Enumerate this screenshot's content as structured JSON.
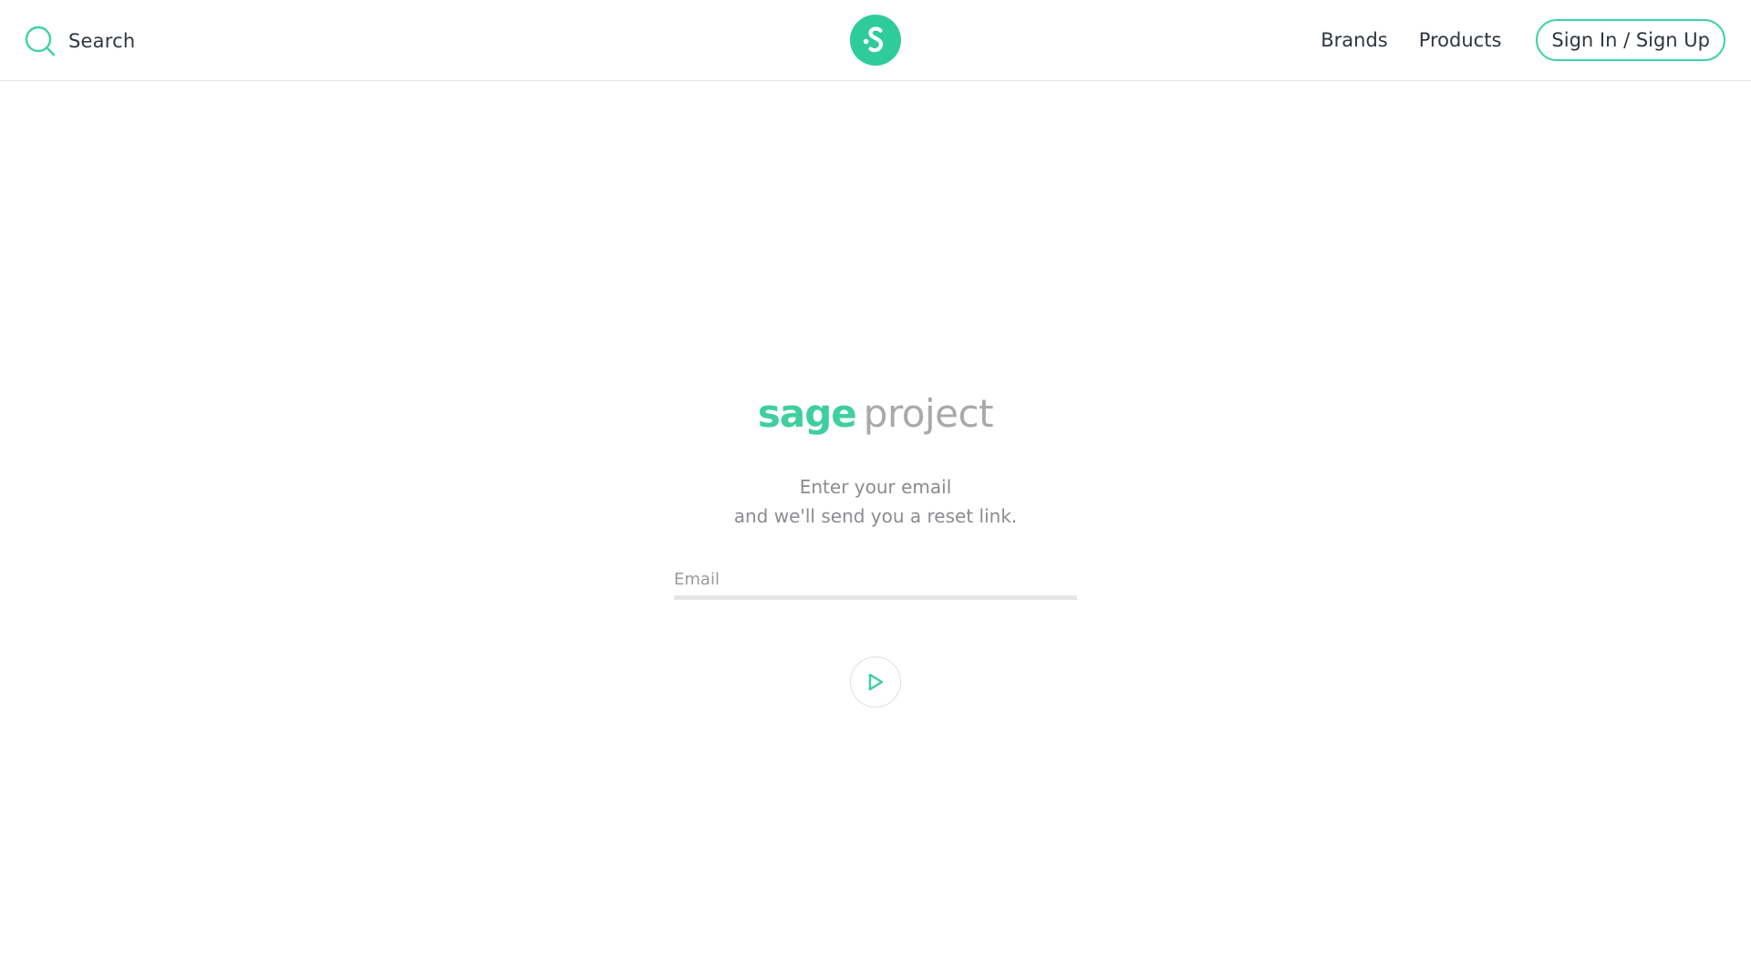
{
  "header": {
    "search_label": "Search",
    "search_icon": "search-icon",
    "logo_icon": "sage-s-logo-icon",
    "nav": {
      "brands": "Brands",
      "products": "Products"
    },
    "signin_label": "Sign In / Sign Up"
  },
  "main": {
    "brand_part1": "sage",
    "brand_part2": "project",
    "instruction_line1": "Enter your email",
    "instruction_line2": "and we'll send you a reset link.",
    "email_placeholder": "Email",
    "email_value": "",
    "submit_icon": "play-arrow-icon"
  },
  "colors": {
    "accent": "#3ecf9f",
    "logo_bg": "#2ecc9a",
    "text_dark": "#2f3640",
    "text_muted": "#8b8b90",
    "brand_gray": "#a9a9ab",
    "divider": "#e6e6e6"
  }
}
